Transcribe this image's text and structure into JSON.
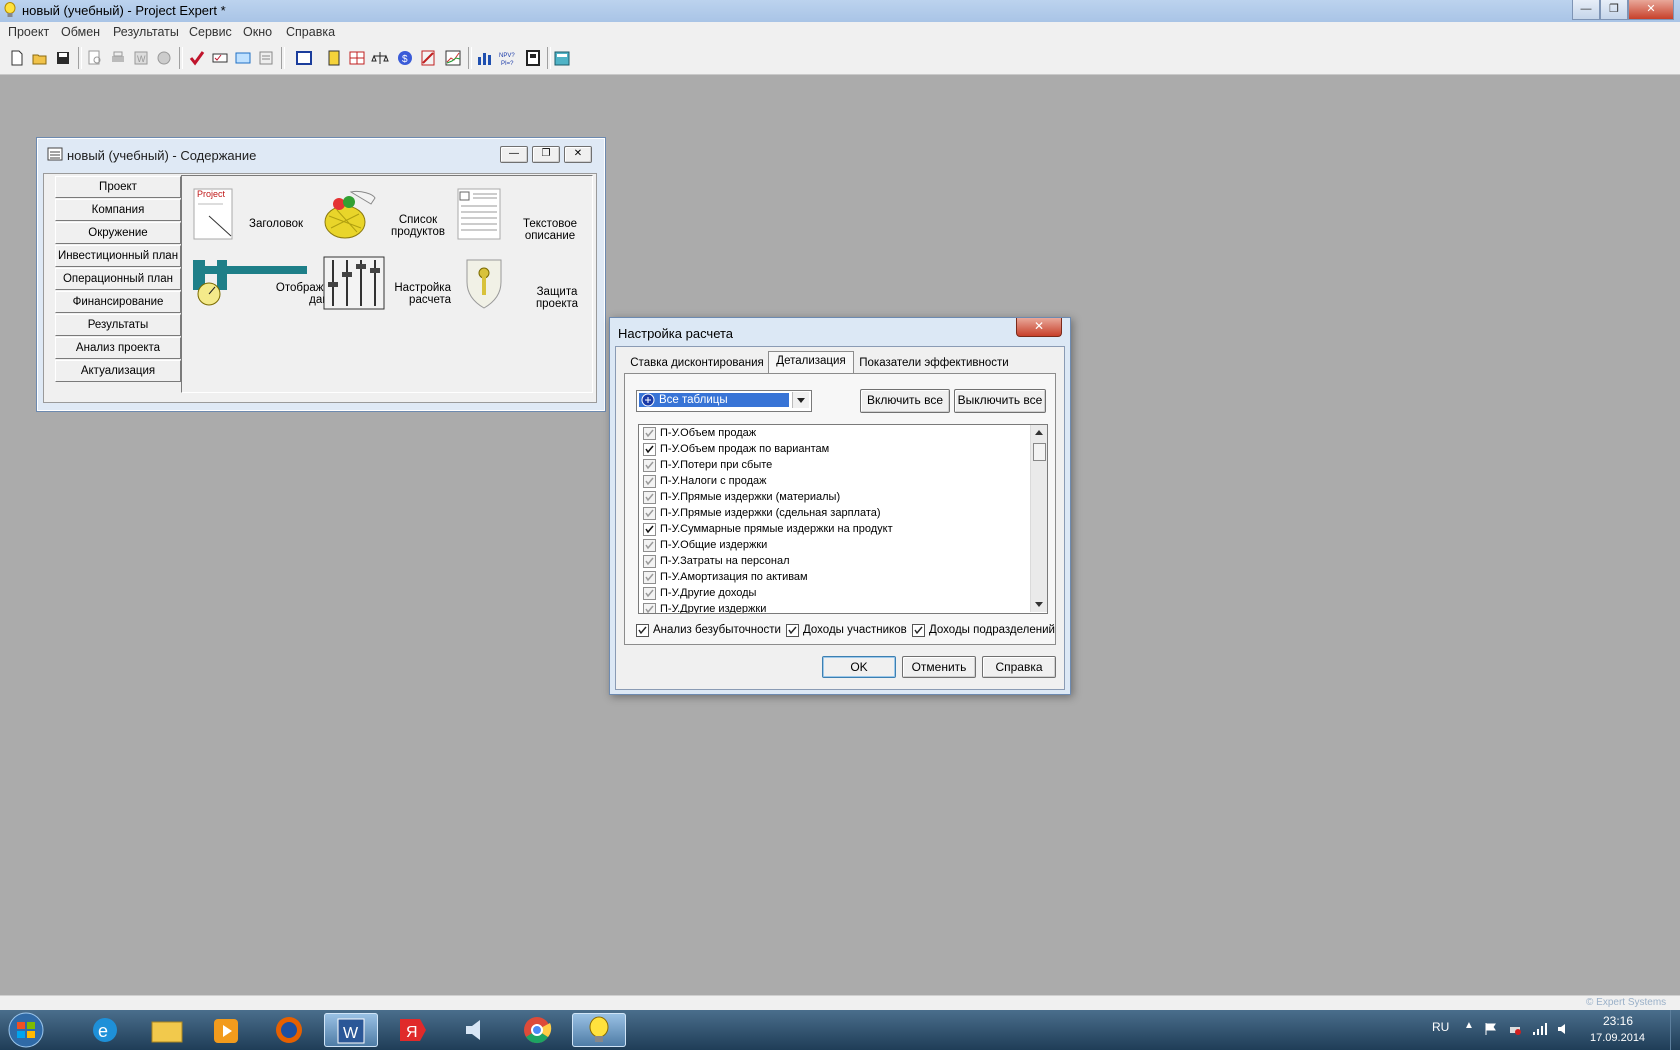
{
  "app": {
    "title": "новый (учебный) - Project Expert *",
    "window_controls": [
      "minimize",
      "restore",
      "close"
    ]
  },
  "menu": [
    "Проект",
    "Обмен",
    "Результаты",
    "Сервис",
    "Окно",
    "Справка"
  ],
  "toolbar_icons": [
    "new-icon",
    "open-icon",
    "save-icon",
    "preview-icon",
    "print-icon",
    "word-icon",
    "settings-icon",
    "check-icon",
    "check-list-icon",
    "refresh-icon",
    "notes-icon",
    "report-icon",
    "table-icon",
    "chart-cf-icon",
    "balance-icon",
    "dollar-icon",
    "edit-chart-icon",
    "line-chart-icon",
    "indicators-icon",
    "npv-icon",
    "tools-icon",
    "calc-icon"
  ],
  "content_window": {
    "title": "новый (учебный) - Содержание",
    "sections": [
      "Проект",
      "Компания",
      "Окружение",
      "Инвестиционный план",
      "Операционный план",
      "Финансирование",
      "Результаты",
      "Анализ проекта",
      "Актуализация"
    ],
    "items": {
      "header": {
        "image_text": "Project",
        "label": "Заголовок"
      },
      "products": {
        "line1": "Список",
        "line2": "продуктов"
      },
      "text": {
        "line1": "Текстовое",
        "line2": "описание"
      },
      "display": {
        "line1": "Отображение",
        "line2": "данных"
      },
      "calc": {
        "line1": "Настройка",
        "line2": "расчета"
      },
      "protect": {
        "line1": "Защита",
        "line2": "проекта"
      }
    }
  },
  "dialog": {
    "title": "Настройка расчета",
    "tabs": [
      "Ставка дисконтирования",
      "Детализация",
      "Показатели эффективности"
    ],
    "active_tab": 1,
    "dropdown_value": "Все таблицы",
    "btn_enable_all": "Включить все",
    "btn_disable_all": "Выключить все",
    "list": [
      {
        "label": "П-У.Объем продаж",
        "checked": true,
        "enabled": false
      },
      {
        "label": "П-У.Объем продаж по вариантам",
        "checked": true,
        "enabled": true
      },
      {
        "label": "П-У.Потери при сбыте",
        "checked": true,
        "enabled": false
      },
      {
        "label": "П-У.Налоги с продаж",
        "checked": true,
        "enabled": false
      },
      {
        "label": "П-У.Прямые издержки (материалы)",
        "checked": true,
        "enabled": false
      },
      {
        "label": "П-У.Прямые издержки (сдельная зарплата)",
        "checked": true,
        "enabled": false
      },
      {
        "label": "П-У.Суммарные прямые издержки на продукт",
        "checked": true,
        "enabled": true
      },
      {
        "label": "П-У.Общие издержки",
        "checked": true,
        "enabled": false
      },
      {
        "label": "П-У.Затраты на персонал",
        "checked": true,
        "enabled": false
      },
      {
        "label": "П-У.Амортизация по активам",
        "checked": true,
        "enabled": false
      },
      {
        "label": "П-У.Другие доходы",
        "checked": true,
        "enabled": false
      },
      {
        "label": "П-У.Другие издержки",
        "checked": true,
        "enabled": false
      }
    ],
    "bottom_checks": [
      {
        "label": "Анализ безубыточности",
        "checked": true
      },
      {
        "label": "Доходы участников",
        "checked": true
      },
      {
        "label": "Доходы подразделений",
        "checked": true
      }
    ],
    "ok": "OK",
    "cancel": "Отменить",
    "help": "Справка"
  },
  "status": {
    "watermark": "© Expert Systems"
  },
  "taskbar": {
    "apps": [
      "windows-start-icon",
      "ie-icon",
      "explorer-icon",
      "media-player-icon",
      "firefox-icon",
      "word-icon",
      "yandex-icon",
      "speaker-app-icon",
      "chrome-icon",
      "project-expert-icon"
    ],
    "lang": "RU",
    "time": "23:16",
    "date": "17.09.2014"
  }
}
